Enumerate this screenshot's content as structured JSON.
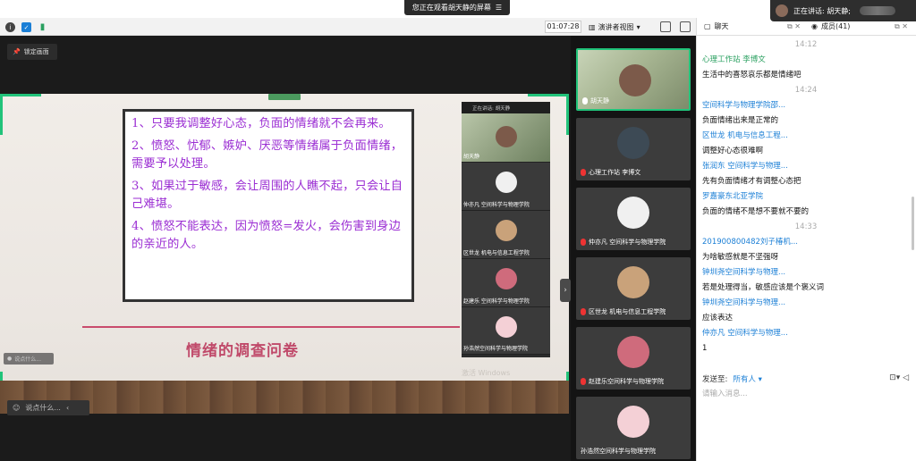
{
  "banner": {
    "watching": "您正在观看胡天静的屏幕",
    "speaking": "正在讲话: 胡天静;"
  },
  "toolbar": {
    "timer": "01:07:28",
    "view": "演讲者视图"
  },
  "stage": {
    "lock": "锁定画面",
    "slide_lines": [
      "1、只要我调整好心态，负面的情绪就不会再来。",
      "2、愤怒、忧郁、嫉妒、厌恶等情绪属于负面情绪，需要予以处理。",
      "3、如果过于敏感，会让周围的人瞧不起，只会让自己难堪。",
      "4、愤怒不能表达，因为愤怒=发火，会伤害到身边的亲近的人。"
    ],
    "slide_title": "情绪的调查问卷",
    "activate": "激活 Windows",
    "chat_small": "说点什么...",
    "chat_bar": "说点什么..."
  },
  "mini": {
    "header": "正在讲话: 胡天静",
    "tiles": [
      {
        "label": "胡天静"
      },
      {
        "label": "仲亦凡 空间科学与物理学院"
      },
      {
        "label": "区世龙 机电与信息工程学院"
      },
      {
        "label": "赵建乐 空间科学与物理学院"
      },
      {
        "label": "孙浩然空间科学与物理学院"
      }
    ]
  },
  "gallery": [
    {
      "label": "胡天静"
    },
    {
      "label": "心理工作站 李博文"
    },
    {
      "label": "仲亦凡 空间科学与物理学院"
    },
    {
      "label": "区世龙 机电与信息工程学院"
    },
    {
      "label": "赵建乐空间科学与物理学院"
    },
    {
      "label": "孙浩然空间科学与物理学院"
    }
  ],
  "chat": {
    "tab_chat": "聊天",
    "tab_members": "成员(41)",
    "messages": [
      {
        "kind": "time",
        "text": "14:12"
      },
      {
        "kind": "name-green",
        "text": "心理工作站 李博文"
      },
      {
        "kind": "text",
        "text": "生活中的喜怒哀乐都是情绪吧"
      },
      {
        "kind": "time",
        "text": "14:24"
      },
      {
        "kind": "name",
        "text": "空间科学与物理学院邵..."
      },
      {
        "kind": "text",
        "text": "负面情绪出来是正常的"
      },
      {
        "kind": "name",
        "text": "区世龙 机电与信息工程..."
      },
      {
        "kind": "text",
        "text": "调整好心态很难啊"
      },
      {
        "kind": "name",
        "text": "张润东 空间科学与物理..."
      },
      {
        "kind": "text",
        "text": "先有负面情绪才有调整心态把"
      },
      {
        "kind": "name",
        "text": "罗嘉豪东北亚学院"
      },
      {
        "kind": "text",
        "text": "负面的情绪不是想不要就不要的"
      },
      {
        "kind": "time",
        "text": "14:33"
      },
      {
        "kind": "name",
        "text": "201900800482刘子椿机..."
      },
      {
        "kind": "text",
        "text": "为啥敏感就是不坚强呀"
      },
      {
        "kind": "name",
        "text": "钟圳尧空间科学与物理..."
      },
      {
        "kind": "text",
        "text": "若是处理得当，敏感应该是个褒义词"
      },
      {
        "kind": "name",
        "text": "钟圳尧空间科学与物理..."
      },
      {
        "kind": "text",
        "text": "应该表达"
      },
      {
        "kind": "name",
        "text": "仲亦凡 空间科学与物理..."
      },
      {
        "kind": "text",
        "text": "1"
      }
    ],
    "send_label": "发送至:",
    "send_to": "所有人",
    "input_placeholder": "请输入消息..."
  }
}
